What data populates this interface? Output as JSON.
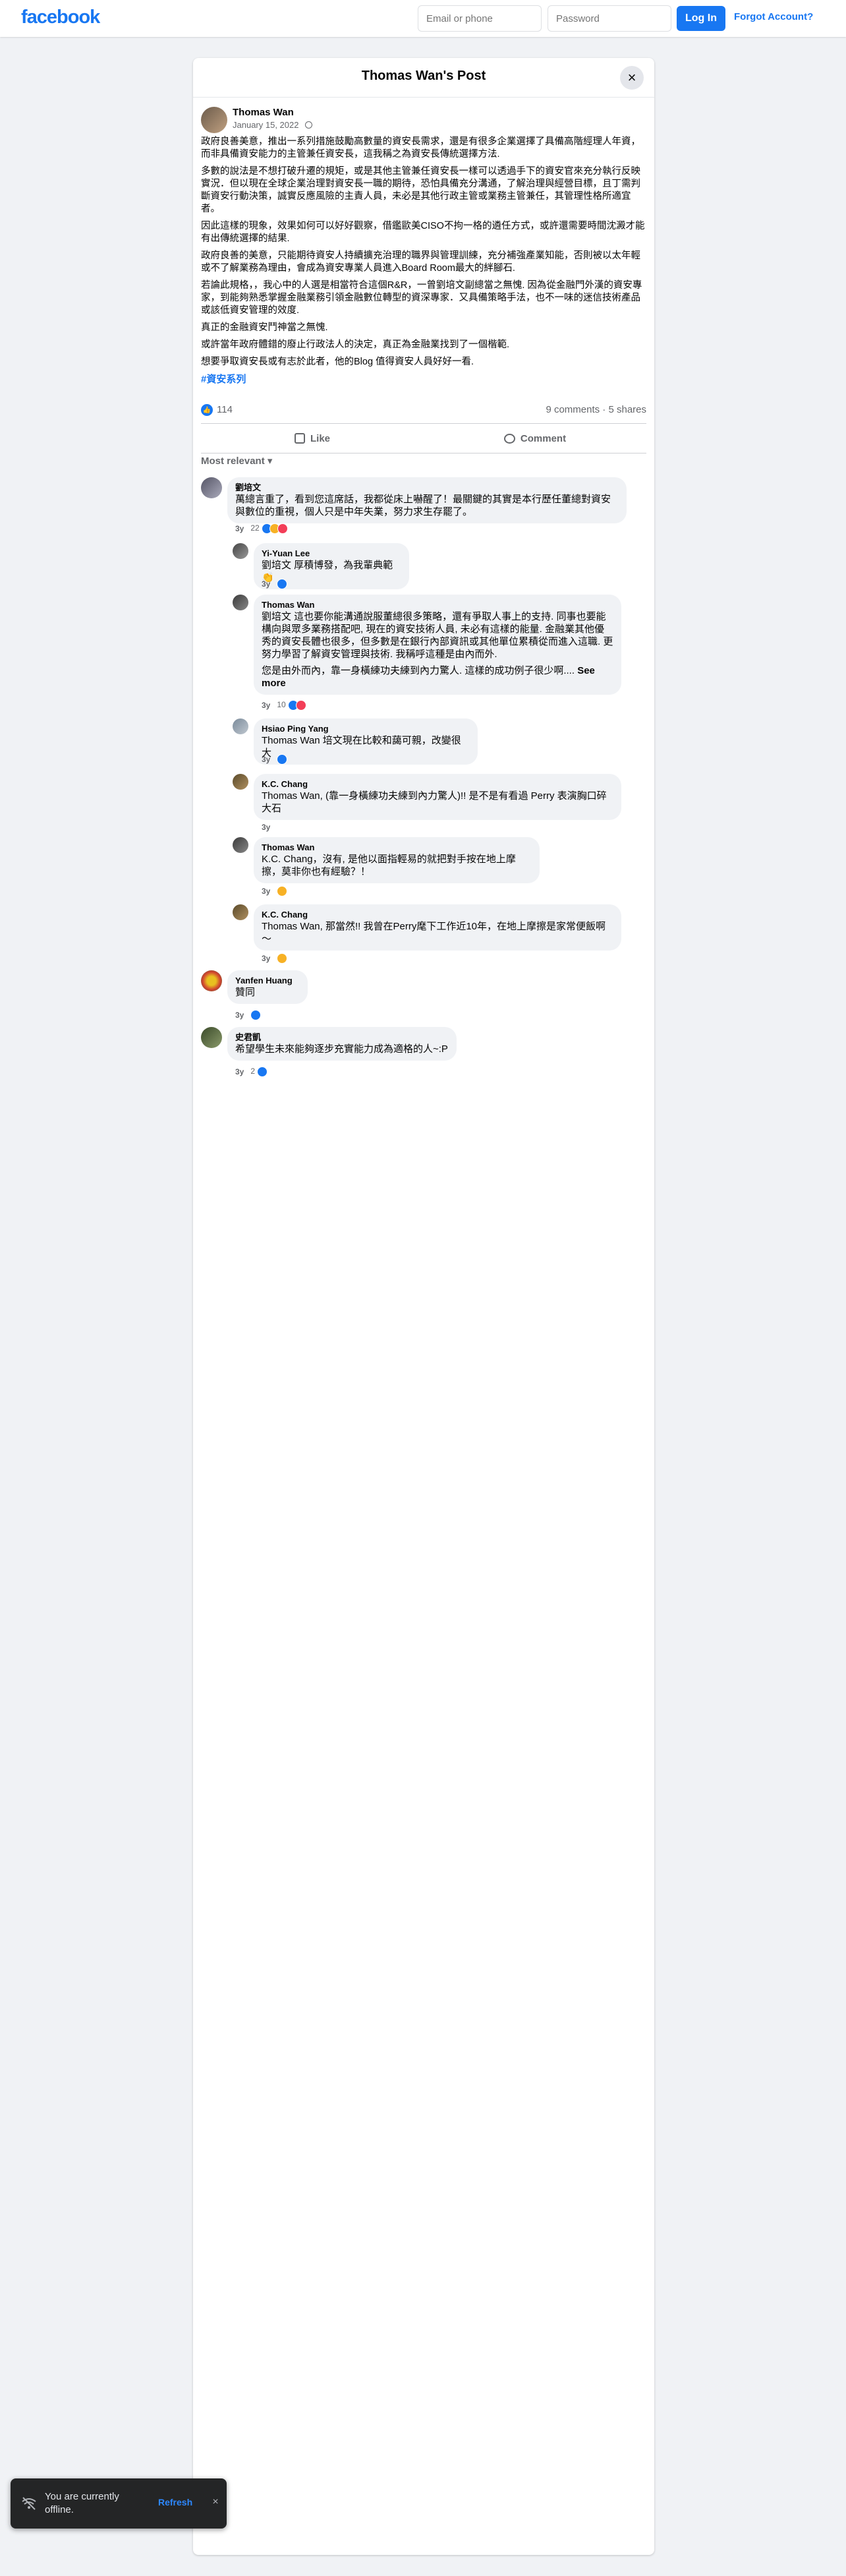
{
  "topbar": {
    "logo": "facebook",
    "email_placeholder": "Email or phone",
    "password_placeholder": "Password",
    "login_label": "Log In",
    "forgot_label": "Forgot Account?"
  },
  "post": {
    "modal_title": "Thomas Wan's Post",
    "close_icon": "×",
    "author": "Thomas Wan",
    "date": "January 15, 2022",
    "paragraphs": [
      "政府良善美意，推出一系列措施鼓勵高數量的資安長需求，還是有很多企業選擇了具備高階經理人年資，而非具備資安能力的主管兼任資安長，這我稱之為資安長傳統選擇方法.",
      "多數的說法是不想打破升遷的規矩，或是其他主管兼任資安長一樣可以透過手下的資安官來充分執行反映實況．但以現在全球企業治理對資安長一職的期待，恐怕具備充分溝通，了解治理與經營目標，且丁需判斷資安行動決策，誠實反應風險的主責人員，未必是其他行政主管或業務主管兼任，其管理性格所適宜者。",
      "因此這樣的現象，效果如何可以好好觀察，借鑑歐美CISO不拘一格的遴任方式，或許還需要時間沈澱才能有出傳統選擇的結果.",
      "政府良善的美意，只能期待資安人持續擴充治理的職界與管理訓練，充分補強產業知能，否則被以太年輕或不了解業務為理由，會成為資安專業人員進入Board Room最大的絆腳石.",
      "若論此規格，，我心中的人選是相當符合這個R&R，一曾劉培文副總當之無愧. 因為從金融門外漢的資安專家，到能夠熟悉掌握金融業務引領金融數位轉型的資深專家．又具備策略手法，也不一味的迷信技術產品或該低資安管理的效度.",
      "真正的金融資安鬥神當之無愧.",
      "或許當年政府體錯的廢止行政法人的決定，真正為金融業找到了一個楷範.",
      "想要爭取資安長或有志於此者，他的Blog 值得資安人員好好一看."
    ],
    "hashtag": "#資安系列",
    "like_count": "114",
    "comments_shares": "9 comments · 5 shares",
    "like_label": "Like",
    "comment_label": "Comment",
    "sort_label": "Most relevant ▾"
  },
  "comments": [
    {
      "name": "劉培文",
      "text": "萬總言重了，看到您這席話，我都從床上嚇醒了！最關鍵的其實是本行歷任董總對資安與數位的重視，個人只是中年失業，努力求生存罷了。",
      "time": "3y",
      "reactions": "22"
    },
    {
      "name": "Yi-Yuan Lee",
      "text": "劉培文 厚積博發，為我輩典範👏",
      "time": "3y",
      "reactions": ""
    },
    {
      "name": "Thomas Wan",
      "text": "劉培文 這也要你能溝通說服董總很多策略，還有爭取人事上的支持. 同事也要能構向與眾多業務搭配吧, 現在的資安技術人員, 未必有這樣的能量. 金融業其他優秀的資安長體也很多，但多數是在銀行內部資訊或其他單位累積從而進入這職. 更努力學習了解資安管理與技術. 我稱呼這種是由內而外.",
      "text2": "您是由外而內，靠一身橫練功夫練到內力驚人. 這樣的成功例子很少啊....",
      "see_more": "See more",
      "time": "3y",
      "reactions": "10"
    },
    {
      "name": "Hsiao Ping Yang",
      "text": "Thomas Wan 培文現在比較和藹可親，改變很大",
      "time": "3y",
      "reactions": ""
    },
    {
      "name": "K.C. Chang",
      "text": "Thomas Wan, (靠一身橫練功夫練到內力驚人)!! 是不是有看過 Perry 表演胸口碎大石",
      "time": "3y",
      "reactions": ""
    },
    {
      "name": "Thomas Wan",
      "text": "K.C. Chang，沒有, 是他以面指輕易的就把對手按在地上摩擦，莫非你也有經驗？！",
      "time": "3y",
      "reactions": ""
    },
    {
      "name": "K.C. Chang",
      "text": "Thomas Wan, 那當然!! 我曾在Perry麾下工作近10年，在地上摩擦是家常便飯啊～",
      "time": "3y",
      "reactions": ""
    },
    {
      "name": "Yanfen Huang",
      "text": "贊同",
      "time": "3y",
      "reactions": ""
    },
    {
      "name": "史君凱",
      "text": "希望學生未來能夠逐步充實能力成為適格的人~:P",
      "time": "3y",
      "reactions": "2"
    }
  ],
  "toast": {
    "message": "You are currently offline.",
    "refresh_label": "Refresh",
    "close_icon": "×",
    "wifi_icon": "wifi-off-icon"
  },
  "colors": {
    "brand": "#1877f2",
    "background": "#f0f2f5",
    "bubble": "#f0f2f5",
    "text": "#050505",
    "muted": "#65676b"
  }
}
